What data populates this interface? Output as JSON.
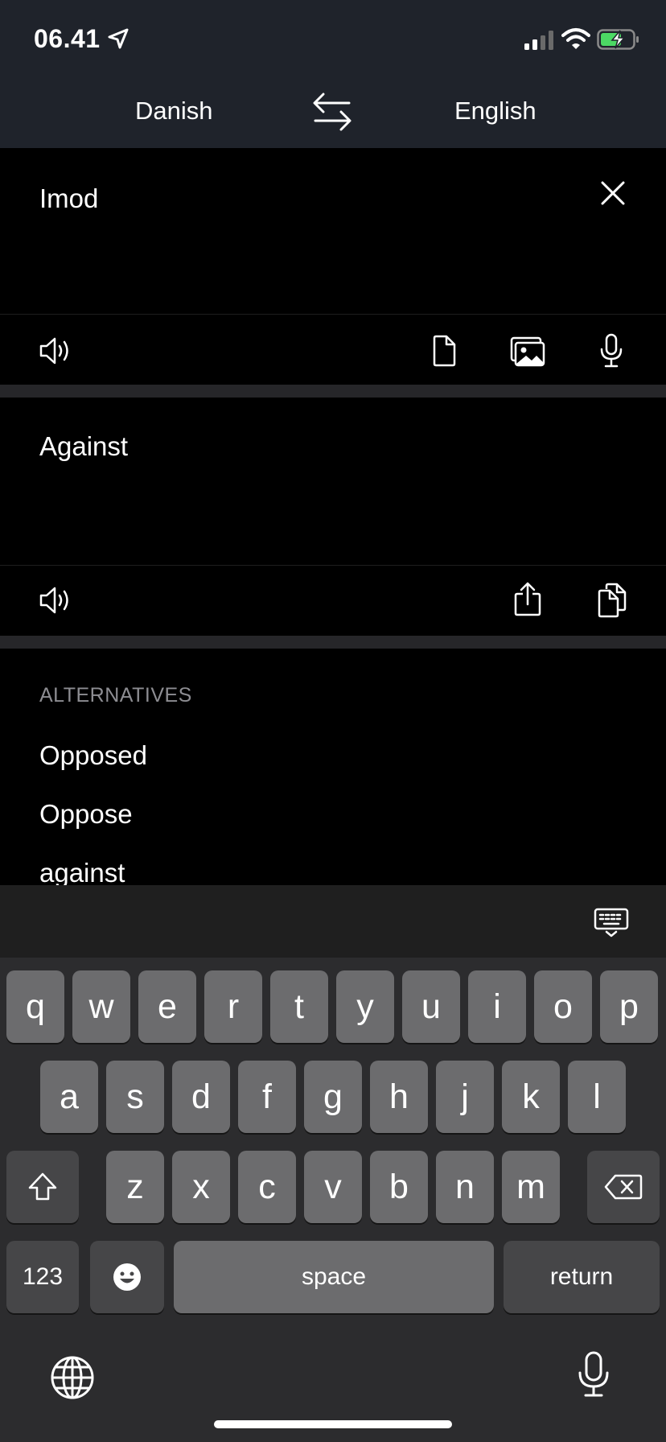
{
  "status_bar": {
    "time": "06.41"
  },
  "languages": {
    "source": "Danish",
    "target": "English"
  },
  "source": {
    "text": "Imod"
  },
  "target": {
    "text": "Against"
  },
  "alternatives": {
    "header": "ALTERNATIVES",
    "items": [
      "Opposed",
      "Oppose",
      "against"
    ]
  },
  "keyboard": {
    "row1": [
      "q",
      "w",
      "e",
      "r",
      "t",
      "y",
      "u",
      "i",
      "o",
      "p"
    ],
    "row2": [
      "a",
      "s",
      "d",
      "f",
      "g",
      "h",
      "j",
      "k",
      "l"
    ],
    "row3": [
      "z",
      "x",
      "c",
      "v",
      "b",
      "n",
      "m"
    ],
    "numbers_label": "123",
    "space_label": "space",
    "return_label": "return"
  }
}
